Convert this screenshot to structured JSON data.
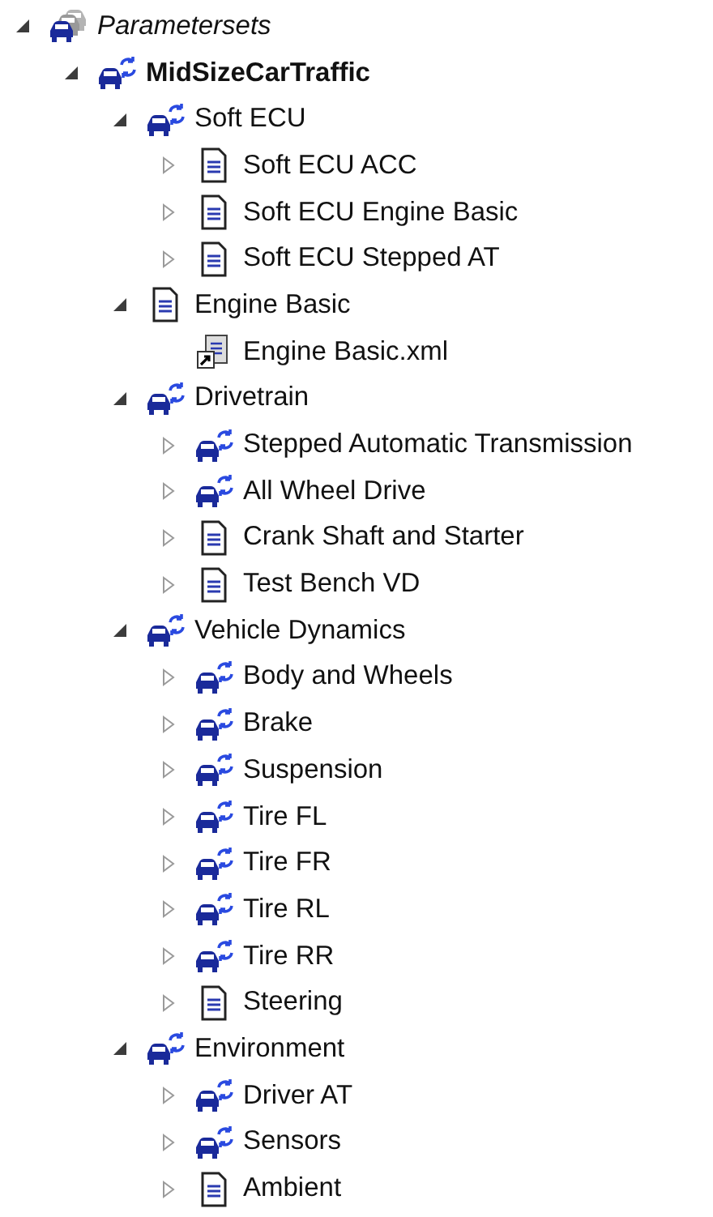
{
  "tree": [
    {
      "label": "Parametersets",
      "kind": "root",
      "italic": true,
      "expanded": true,
      "children": [
        {
          "label": "MidSizeCarTraffic",
          "kind": "set",
          "bold": true,
          "expanded": true,
          "children": [
            {
              "label": "Soft ECU",
              "kind": "set",
              "expanded": true,
              "children": [
                {
                  "label": "Soft ECU ACC",
                  "kind": "doc",
                  "expanded": false
                },
                {
                  "label": "Soft ECU Engine Basic",
                  "kind": "doc",
                  "expanded": false
                },
                {
                  "label": "Soft ECU Stepped AT",
                  "kind": "doc",
                  "expanded": false
                }
              ]
            },
            {
              "label": "Engine Basic",
              "kind": "doc",
              "expanded": true,
              "children": [
                {
                  "label": "Engine Basic.xml",
                  "kind": "file"
                }
              ]
            },
            {
              "label": "Drivetrain",
              "kind": "set",
              "expanded": true,
              "children": [
                {
                  "label": "Stepped Automatic Transmission",
                  "kind": "set",
                  "expanded": false
                },
                {
                  "label": "All Wheel Drive",
                  "kind": "set",
                  "expanded": false
                },
                {
                  "label": "Crank Shaft and Starter",
                  "kind": "doc",
                  "expanded": false
                },
                {
                  "label": "Test Bench VD",
                  "kind": "doc",
                  "expanded": false
                }
              ]
            },
            {
              "label": "Vehicle Dynamics",
              "kind": "set",
              "expanded": true,
              "children": [
                {
                  "label": "Body and Wheels",
                  "kind": "set",
                  "expanded": false
                },
                {
                  "label": "Brake",
                  "kind": "set",
                  "expanded": false
                },
                {
                  "label": "Suspension",
                  "kind": "set",
                  "expanded": false
                },
                {
                  "label": "Tire FL",
                  "kind": "set",
                  "expanded": false
                },
                {
                  "label": "Tire FR",
                  "kind": "set",
                  "expanded": false
                },
                {
                  "label": "Tire RL",
                  "kind": "set",
                  "expanded": false
                },
                {
                  "label": "Tire RR",
                  "kind": "set",
                  "expanded": false
                },
                {
                  "label": "Steering",
                  "kind": "doc",
                  "expanded": false
                }
              ]
            },
            {
              "label": "Environment",
              "kind": "set",
              "expanded": true,
              "children": [
                {
                  "label": "Driver AT",
                  "kind": "set",
                  "expanded": false
                },
                {
                  "label": "Sensors",
                  "kind": "set",
                  "expanded": false
                },
                {
                  "label": "Ambient",
                  "kind": "doc",
                  "expanded": false
                }
              ]
            }
          ]
        }
      ]
    }
  ]
}
